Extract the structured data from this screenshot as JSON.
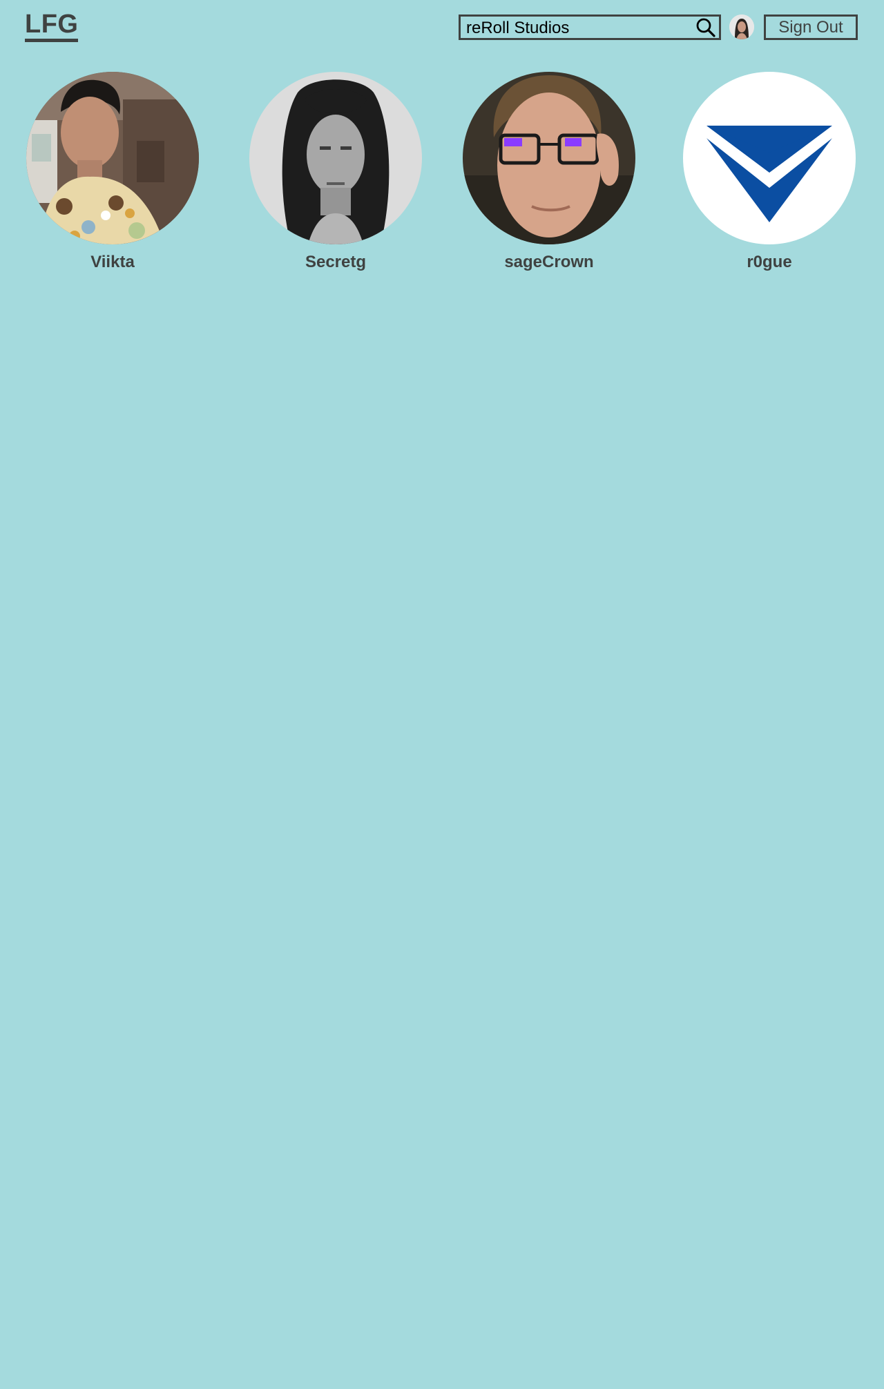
{
  "header": {
    "logo": "LFG",
    "search": {
      "value": "reRoll Studios",
      "placeholder": "",
      "icon": "search-icon"
    },
    "avatar_icon": "user-avatar",
    "signout_label": "Sign Out"
  },
  "members": [
    {
      "name": "Viikta",
      "avatar": "photo-man-floral-shirt"
    },
    {
      "name": "Secretg",
      "avatar": "photo-man-long-hair-grayscale"
    },
    {
      "name": "sageCrown",
      "avatar": "photo-man-glasses"
    },
    {
      "name": "r0gue",
      "avatar": "blue-chevron-logo"
    }
  ],
  "colors": {
    "background": "#a4dadd",
    "text": "#3f4241",
    "logo_blue": "#0b4ea2"
  }
}
